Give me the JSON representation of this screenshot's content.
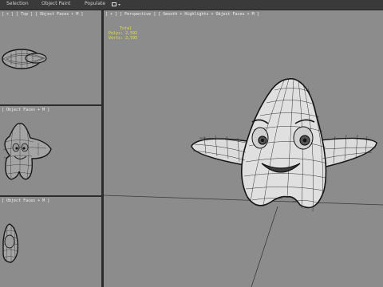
{
  "menubar": {
    "items": [
      "Selection",
      "Object Paint",
      "Populate"
    ],
    "icon": "image-toggle-icon"
  },
  "viewports": {
    "top": {
      "label": "[ + ] [ Top ] [ Object Faces + M ]"
    },
    "front": {
      "label": "[ Object Faces + M ]"
    },
    "left": {
      "label": "[ Object Faces + M ]"
    },
    "perspective": {
      "label": "[ + ] [ Perspective ] [ Smooth + Highlights + Object Faces + M ]"
    }
  },
  "stats": {
    "total_label": "Total",
    "polys": "Polys: 2,592",
    "verts": "Verts: 2,595"
  },
  "colors": {
    "viewport_bg": "#8c8c8c",
    "wire": "#161616",
    "stats_text": "#e4e04a",
    "menubar_bg": "#3a3a3a"
  }
}
